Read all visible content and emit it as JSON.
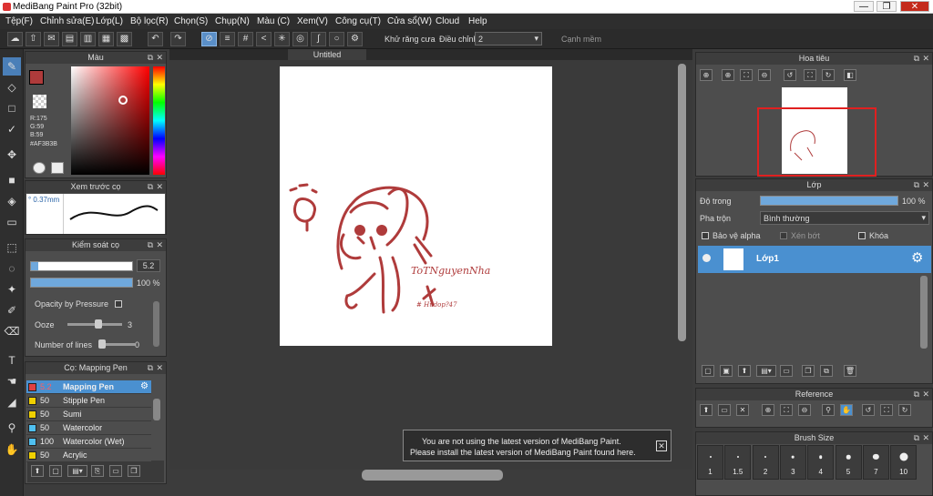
{
  "window": {
    "title": "MediBang Paint Pro (32bit)",
    "min": "—",
    "max": "❐",
    "close": "✕"
  },
  "menu": [
    "Tệp(F)",
    "Chỉnh sửa(E)",
    "Lớp(L)",
    "Bộ lọc(R)",
    "Chọn(S)",
    "Chụp(N)",
    "Màu (C)",
    "Xem(V)",
    "Công cụ(T)",
    "Cửa sổ(W)",
    "Cloud",
    "Help"
  ],
  "toolbar": {
    "antialias_label": "Khử răng cưa",
    "adjust_label": "Điều chỉnh",
    "adjust_value": "2",
    "margin_label": "Cạnh mềm"
  },
  "document": {
    "tab_title": "Untitled",
    "handwriting_1": "ToTNguyenNha",
    "handwriting_2": "# Hudop?47"
  },
  "color_panel": {
    "title": "Màu",
    "r": "R:175",
    "g": "G:59",
    "b": "B:59",
    "hex": "#AF3B3B",
    "fg_color": "#AF3B3B"
  },
  "brush_preview": {
    "title": "Xem trước cọ",
    "size": "° 0.37mm"
  },
  "brush_control": {
    "title": "Kiểm soát cọ",
    "size_value": "5.2",
    "opacity_value": "100 %",
    "opacity_pressure_label": "Opacity by Pressure",
    "ooze_label": "Ooze",
    "ooze_value": "3",
    "lines_label": "Number of lines",
    "lines_value": "0"
  },
  "brush_list": {
    "title": "Cọ: Mapping Pen",
    "items": [
      {
        "size": "5.2",
        "name": "Mapping Pen",
        "color": "#e04040",
        "selected": true
      },
      {
        "size": "50",
        "name": "Stipple Pen",
        "color": "#f0d000"
      },
      {
        "size": "50",
        "name": "Sumi",
        "color": "#f0d000"
      },
      {
        "size": "50",
        "name": "Watercolor",
        "color": "#4fc0f0"
      },
      {
        "size": "100",
        "name": "Watercolor (Wet)",
        "color": "#4fc0f0"
      },
      {
        "size": "50",
        "name": "Acrylic",
        "color": "#f0d000"
      }
    ]
  },
  "navigator": {
    "title": "Hoa tiêu"
  },
  "layer_panel": {
    "title": "Lớp",
    "opacity_label": "Độ trong",
    "opacity_value": "100 %",
    "blend_label": "Pha trộn",
    "blend_value": "Bình thường",
    "protect_alpha": "Bảo vệ alpha",
    "clipping": "Xén bớt",
    "lock": "Khóa",
    "layer_name": "Lớp1"
  },
  "reference_panel": {
    "title": "Reference"
  },
  "brush_size_panel": {
    "title": "Brush Size",
    "sizes": [
      "1",
      "1.5",
      "2",
      "3",
      "4",
      "5",
      "7",
      "10"
    ]
  },
  "notification": {
    "line1": "You are not using the latest version of MediBang Paint.",
    "line2": "Please install the latest version of MediBang Paint found here.",
    "close": "✕"
  }
}
